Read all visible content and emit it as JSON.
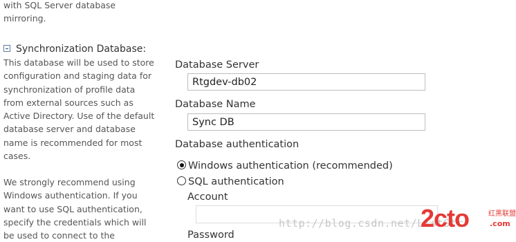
{
  "left": {
    "intro_line1": "with SQL Server database",
    "intro_line2": "mirroring.",
    "section_title": "Synchronization Database:",
    "description_lines": [
      "This database will be used to store",
      "configuration and staging data for",
      "synchronization of profile data",
      "from external sources such as",
      "Active Directory. Use of the default",
      "database server and database",
      "name is recommended for most",
      "cases."
    ],
    "recommend_lines": [
      "We strongly recommend using",
      "Windows authentication. If you",
      "want to use SQL authentication,",
      "specify the credentials which will",
      "be used to connect to the"
    ]
  },
  "form": {
    "server_label": "Database Server",
    "server_value": "Rtgdev-db02",
    "name_label": "Database Name",
    "name_value": "Sync DB",
    "auth_label": "Database authentication",
    "windows_auth_label": "Windows authentication (recommended)",
    "sql_auth_label": "SQL authentication",
    "account_label": "Account",
    "account_value": "",
    "password_label": "Password"
  },
  "watermark": {
    "url": "http://blog.csdn.net/ListStr",
    "logo": "2cto",
    "logo_sub": "红黑联盟",
    "logo_suffix": ".com"
  },
  "colors": {
    "logo": "#e53935",
    "text": "#333333",
    "border": "#bdbdbd"
  }
}
